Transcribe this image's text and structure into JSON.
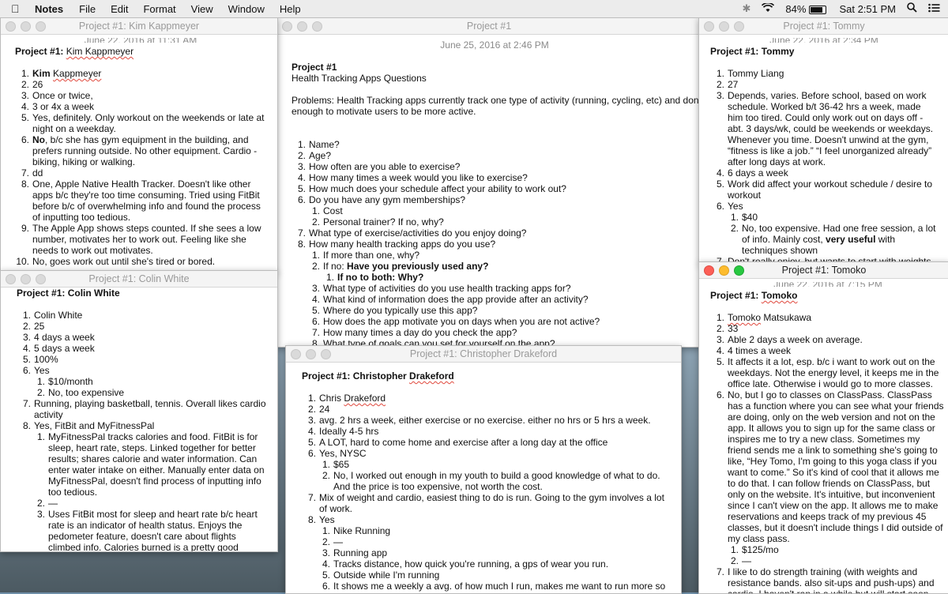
{
  "menubar": {
    "app": "Notes",
    "items": [
      "File",
      "Edit",
      "Format",
      "View",
      "Window",
      "Help"
    ],
    "battery": "84%",
    "clock": "Sat 2:51 PM"
  },
  "windows": {
    "kim": {
      "title": "Project #1: Kim Kappmeyer",
      "date": "June 22, 2016 at 11:31 AM",
      "header_prefix": "Project #1:",
      "header_name": "Kim Kappmeyer",
      "items": [
        {
          "n": "1.",
          "name_bold": "Kim",
          "name_sq": "Kappmeyer"
        },
        {
          "n": "2.",
          "t": "26"
        },
        {
          "n": "3.",
          "t": "Once or twice,"
        },
        {
          "n": "4.",
          "t": "3 or 4x a week"
        },
        {
          "n": "5.",
          "t": "Yes, definitely. Only workout on the weekends or late at night on a weekday."
        },
        {
          "n": "6.",
          "b": "No",
          "t": ", b/c she has gym equipment in the building, and prefers running outside. No other equipment. Cardio - biking, hiking or walking."
        },
        {
          "n": "7.",
          "t": "dd"
        },
        {
          "n": "8.",
          "t": "One, Apple Native Health Tracker. Doesn't like other apps b/c they're too time consuming. Tried using FitBit before b/c of overwhelming info and found the process of inputting too tedious."
        },
        {
          "n": "9.",
          "t": "The Apple App shows steps counted. If she sees a low number, motivates her to work out. Feeling like she needs to work out motivates."
        },
        {
          "n": "10.",
          "t": "No, goes work out until she's tired or bored."
        }
      ]
    },
    "main": {
      "title": "Project #1",
      "date": "June 25, 2016 at 2:46 PM",
      "header": "Project #1",
      "subtitle": "Health Tracking Apps Questions",
      "problems": "Problems: Health Tracking apps currently track one type of activity (running, cycling, etc) and don't do enough to motivate users to be more active.",
      "items": [
        {
          "n": "1.",
          "t": "Name?"
        },
        {
          "n": "2.",
          "t": "Age?"
        },
        {
          "n": "3.",
          "t": "How often are you able to exercise?"
        },
        {
          "n": "4.",
          "t": "How many times a week would you like to exercise?"
        },
        {
          "n": "5.",
          "t": "How much does your schedule affect your ability to work out?"
        },
        {
          "n": "6.",
          "t": "Do you have any gym memberships?"
        },
        {
          "n": "1.",
          "t": "Cost",
          "lvl": 2
        },
        {
          "n": "2.",
          "t": "Personal trainer? If no, why?",
          "lvl": 2
        },
        {
          "n": "7.",
          "t": "What type of exercise/activities do you enjoy doing?"
        },
        {
          "n": "8.",
          "t": "How many health tracking apps do you use?"
        },
        {
          "n": "1.",
          "t": "If more than one, why?",
          "lvl": 2
        },
        {
          "n": "2.",
          "t": "If no: ",
          "b": "Have you previously used any?",
          "lvl": 2
        },
        {
          "n": "1.",
          "b": "If no to both: Why?",
          "lvl": 3
        },
        {
          "n": "3.",
          "t": "What type of activities do you use health tracking apps for?",
          "lvl": 2
        },
        {
          "n": "4.",
          "t": "What kind of information does the app provide after an activity?",
          "lvl": 2
        },
        {
          "n": "5.",
          "t": "Where do you typically use this app?",
          "lvl": 2
        },
        {
          "n": "6.",
          "t": "How does the app motivate you on days when you are not active?",
          "lvl": 2
        },
        {
          "n": "7.",
          "t": "How many times a day do you check the app?",
          "lvl": 2
        },
        {
          "n": "8.",
          "t": "What type of goals can you set for yourself on the app?",
          "lvl": 2
        }
      ]
    },
    "tommy": {
      "title": "Project #1: Tommy",
      "date": "June 22, 2016 at 2:34 PM",
      "header": "Project #1: Tommy",
      "items": [
        {
          "n": "1.",
          "t": "Tommy Liang"
        },
        {
          "n": "2.",
          "t": "27"
        },
        {
          "n": "3.",
          "t": "Depends, varies. Before school, based on work schedule. Worked b/t 36-42 hrs a week, made him too tired. Could only work out on days off - abt. 3 days/wk, could be weekends or weekdays. Whenever you time. Doesn't unwind at the gym, “fitness is like a job.” “I feel unorganized already” after long days at work."
        },
        {
          "n": "4.",
          "t": "6 days a week"
        },
        {
          "n": "5.",
          "t": "Work did affect your workout schedule / desire to workout"
        },
        {
          "n": "6.",
          "t": "Yes"
        },
        {
          "n": "1.",
          "t": "$40",
          "lvl": 2
        },
        {
          "n": "2.",
          "t": "No, too expensive. Had one free session, a lot of info. Mainly cost, ",
          "b": "very useful",
          "t2": " with techniques shown",
          "lvl": 2
        },
        {
          "n": "7.",
          "t": "Don't really enjoy, but wants to start with weights."
        }
      ]
    },
    "colin": {
      "title": "Project #1: Colin White",
      "header": "Project #1: Colin White",
      "items": [
        {
          "n": "1.",
          "t": "Colin White"
        },
        {
          "n": "2.",
          "t": "25"
        },
        {
          "n": "3.",
          "t": "4 days a week"
        },
        {
          "n": "4.",
          "t": "5 days a week"
        },
        {
          "n": "5.",
          "t": "100%"
        },
        {
          "n": "6.",
          "t": "Yes"
        },
        {
          "n": "1.",
          "t": "$10/month",
          "lvl": 2
        },
        {
          "n": "2.",
          "t": "No, too expensive",
          "lvl": 2
        },
        {
          "n": "7.",
          "t": "Running, playing basketball, tennis. Overall likes cardio activity"
        },
        {
          "n": "8.",
          "t": "Yes, FitBit and MyFitnessPal"
        },
        {
          "n": "1.",
          "t": "MyFitnessPal tracks calories and food. FitBit is for sleep, heart rate, steps. Linked together for better results; shares calorie and water information. Can enter water intake on either. Manually enter data on MyFitnessPal, doesn't find process of inputting info too tedious.",
          "lvl": 2
        },
        {
          "n": "2.",
          "t": "—",
          "lvl": 2
        },
        {
          "n": "3.",
          "t": "Uses FitBit most for sleep and heart rate b/c heart rate is an indicator of health status. Enjoys the pedometer feature, doesn't care about flights climbed info. Calories burned is a pretty good feature b/c it",
          "lvl": 2
        }
      ]
    },
    "chris": {
      "title": "Project #1: Christopher Drakeford",
      "header_prefix": "Project #1: Christopher",
      "header_name": "Drakeford",
      "items": [
        {
          "n": "1.",
          "t": "Chris ",
          "sq": "Drakeford"
        },
        {
          "n": "2.",
          "t": "24"
        },
        {
          "n": "3.",
          "t": "avg. 2 hrs a week, either exercise or no exercise. either no hrs or 5 hrs a week."
        },
        {
          "n": "4.",
          "t": "Ideally 4-5 hrs"
        },
        {
          "n": "5.",
          "t": "A LOT, hard to come home and exercise after a long day at the office"
        },
        {
          "n": "6.",
          "t": "Yes, NYSC"
        },
        {
          "n": "1.",
          "t": "$65",
          "lvl": 2
        },
        {
          "n": "2.",
          "t": "No, I worked out enough in my youth to build a good knowledge of what to do. And the price is too expensive, not worth the cost.",
          "lvl": 2
        },
        {
          "n": "7.",
          "t": "Mix of weight and cardio, easiest thing to do is run. Going to the gym involves a lot of work."
        },
        {
          "n": "8.",
          "t": "Yes"
        },
        {
          "n": "1.",
          "t": "Nike Running",
          "lvl": 2
        },
        {
          "n": "2.",
          "t": "—",
          "lvl": 2
        },
        {
          "n": "3.",
          "t": "Running app",
          "lvl": 2
        },
        {
          "n": "4.",
          "t": "Tracks distance, how quick you're running, a gps of wear you run.",
          "lvl": 2
        },
        {
          "n": "5.",
          "t": "Outside while I'm running",
          "lvl": 2
        },
        {
          "n": "6.",
          "t": "It shows me a weekly a avg. of how much I run, makes me want to run more so i",
          "lvl": 2
        }
      ]
    },
    "tomoko": {
      "title": "Project #1: Tomoko",
      "date": "June 22, 2016 at 7:15 PM",
      "header_prefix": "Project #1:",
      "header_name": "Tomoko",
      "items": [
        {
          "n": "1.",
          "sq": "Tomoko",
          "t": " Matsukawa"
        },
        {
          "n": "2.",
          "t": "33"
        },
        {
          "n": "3.",
          "t": "Able 2 days a week on average."
        },
        {
          "n": "4.",
          "t": "4 times a week"
        },
        {
          "n": "5.",
          "t": "It affects it a lot, esp. b/c i want to work out on the weekdays. Not the energy level, it keeps me in the office late. Otherwise i would go to more classes."
        },
        {
          "n": "6.",
          "t": "No, but I go to classes on ClassPass. ClassPass has a function where you can see what your friends are doing, only on the web version and not on the app. It allows you to sign up for the same class or inspires me to try a new class. Sometimes my friend sends me a link to something she's going to like, “Hey Tomo, I'm going to this yoga class if you want to come.” So it's kind of cool that it allows me to do that. I can follow friends on ClassPass, but only on the website. It's intuitive, but inconvenient since I can't view on the app. It allows me to make reservations and keeps track of my previous 45 classes, but it doesn't include things I did outside of my class pass."
        },
        {
          "n": "1.",
          "t": "$125/mo",
          "lvl": 2
        },
        {
          "n": "2.",
          "t": "—",
          "lvl": 2
        },
        {
          "n": "7.",
          "t": "I like to do strength training (with weights and resistance bands. also sit-ups and push-ups) and cardio. I haven't ran in a while but will start soon since the weather is nicer. Work affects my ability to run as"
        }
      ]
    }
  }
}
